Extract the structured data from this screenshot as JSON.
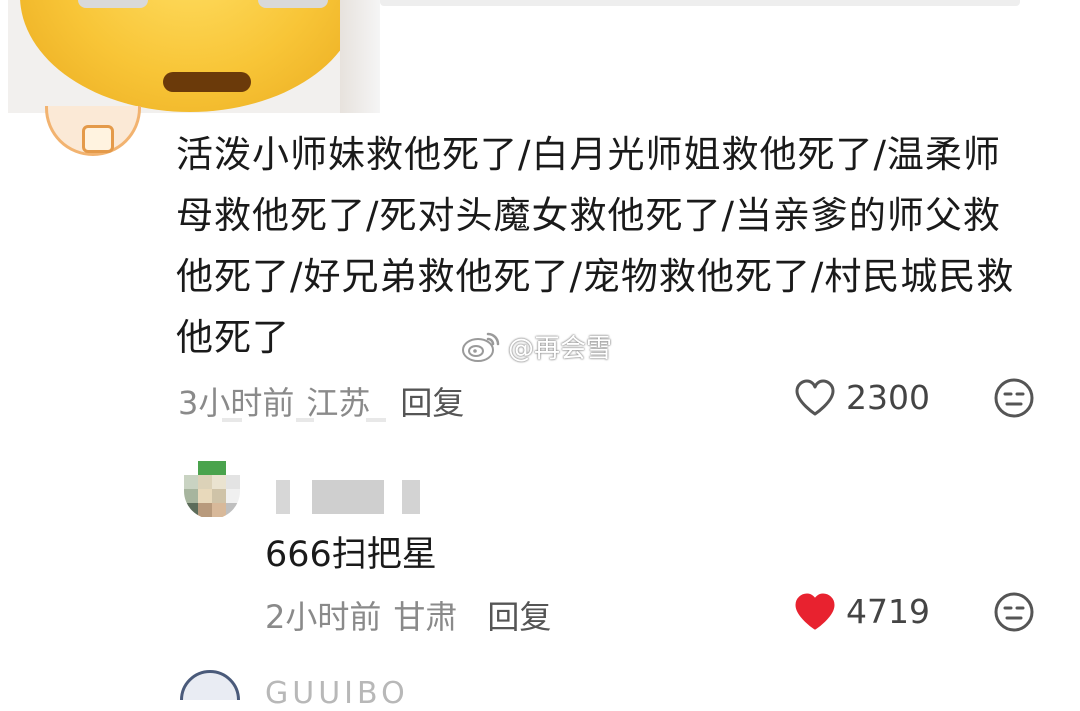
{
  "comment": {
    "text": "活泼小师妹救他死了/白月光师姐救他死了/温柔师母救他死了/死对头魔女救他死了/当亲爹的师父救他死了/好兄弟救他死了/宠物救他死了/村民城民救他死了",
    "time": "3小时前",
    "location": "江苏",
    "reply_label": "回复",
    "likes": "2300",
    "liked": false
  },
  "reply": {
    "text": "666扫把星",
    "time": "2小时前",
    "location": "甘肃",
    "reply_label": "回复",
    "likes": "4719",
    "liked": true
  },
  "watermark": {
    "text": "@再会雪"
  },
  "next_comment": {
    "name": "GUUIBO"
  },
  "colors": {
    "like_active": "#e8222f",
    "meta_text": "#8a8a8a"
  }
}
